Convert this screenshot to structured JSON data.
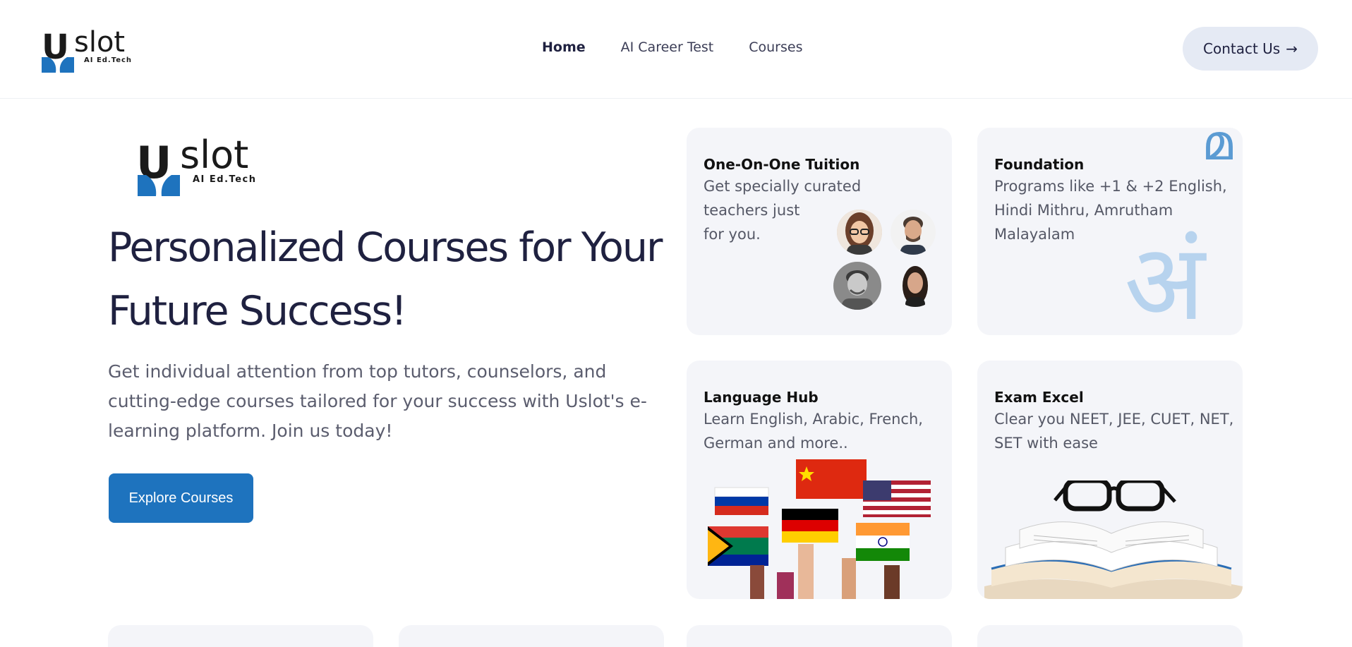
{
  "brand": {
    "wordmark": "slot",
    "letter": "U",
    "tagline": "AI Ed.Tech"
  },
  "nav": {
    "links": [
      {
        "label": "Home",
        "active": true
      },
      {
        "label": "AI Career Test",
        "active": false
      },
      {
        "label": "Courses",
        "active": false
      }
    ],
    "contact_label": "Contact Us",
    "contact_arrow": "→"
  },
  "hero": {
    "title_line1": "Personalized Courses for Your",
    "title_line2": "Future Success!",
    "description": "Get individual attention from top tutors, counselors, and cutting-edge courses tailored for your success with Uslot's e-learning platform. Join us today!",
    "cta_label": "Explore Courses"
  },
  "cards": {
    "tuition": {
      "title": "One-On-One Tuition",
      "desc_l1": "Get specially curated",
      "desc_l2": "teachers just",
      "desc_l3": "for you."
    },
    "foundation": {
      "title": "Foundation",
      "desc_l1": "Programs like +1 & +2 English,",
      "desc_l2": "Hindi Mithru, Amrutham",
      "desc_l3": "Malayalam",
      "glyph_main": "अं",
      "glyph_corner": " മ"
    },
    "language": {
      "title": "Language Hub",
      "desc_l1": "Learn English, Arabic, French,",
      "desc_l2": "German and more.."
    },
    "exam": {
      "title": "Exam Excel",
      "desc_l1": "Clear you NEET, JEE, CUET, NET,",
      "desc_l2": "SET with ease"
    }
  },
  "colors": {
    "accent": "#1e73be",
    "text_dark": "#1f2140",
    "card_bg": "#f4f5f9",
    "logo_blue": "#1e73be"
  }
}
